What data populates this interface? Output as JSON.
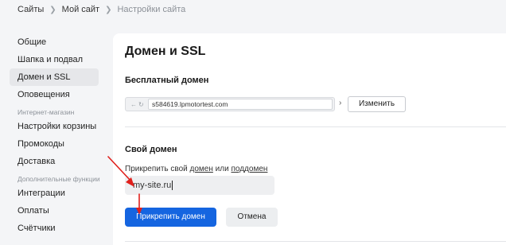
{
  "breadcrumb": [
    "Сайты",
    "Мой сайт",
    "Настройки сайта"
  ],
  "sidebar": {
    "items_top": [
      {
        "label": "Общие"
      },
      {
        "label": "Шапка и подвал"
      },
      {
        "label": "Домен и SSL",
        "active": true
      },
      {
        "label": "Оповещения"
      }
    ],
    "group_shop": "Интернет-магазин",
    "items_shop": [
      {
        "label": "Настройки корзины"
      },
      {
        "label": "Промокоды"
      },
      {
        "label": "Доставка"
      }
    ],
    "group_extra": "Дополнительные функции",
    "items_extra": [
      {
        "label": "Интеграции"
      },
      {
        "label": "Оплаты"
      },
      {
        "label": "Счётчики"
      }
    ]
  },
  "main": {
    "title": "Домен и SSL",
    "free_domain": {
      "heading": "Бесплатный домен",
      "address": "s584619.lpmotortest.com",
      "change_label": "Изменить"
    },
    "own_domain": {
      "heading": "Свой домен",
      "attach_prefix": "Прикрепить свой ",
      "domain_link": "домен",
      "or_text": " или ",
      "subdomain_link": "поддомен",
      "input_value": "my-site.ru",
      "attach_button": "Прикрепить домен",
      "cancel_button": "Отмена"
    }
  },
  "colors": {
    "primary": "#1565e0",
    "annotation": "#e0201c",
    "background": "#f4f5f7"
  },
  "icons": {
    "breadcrumb_separator": "chevron-right-icon",
    "address_nav": "back-forward-icon"
  }
}
